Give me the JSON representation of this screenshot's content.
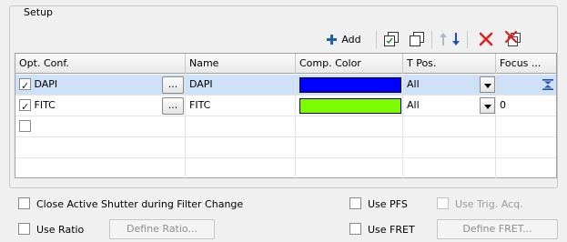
{
  "group": {
    "title": "Setup"
  },
  "toolbar": {
    "add_label": "Add",
    "add_icon": "plus-icon",
    "colors": {
      "plus": "#2060b0",
      "delete": "#e02020",
      "arrow_up": "#b0b8c8",
      "arrow_down": "#2050b0"
    }
  },
  "table": {
    "columns": [
      "Opt. Conf.",
      "Name",
      "Comp. Color",
      "T Pos.",
      "Focus ..."
    ],
    "rows": [
      {
        "checked": true,
        "opt_conf": "DAPI",
        "name": "DAPI",
        "color": "#0000ff",
        "t_pos": "All",
        "focus": "",
        "selected": true
      },
      {
        "checked": true,
        "opt_conf": "FITC",
        "name": "FITC",
        "color": "#7cfc00",
        "t_pos": "All",
        "focus": "0",
        "selected": false
      },
      {
        "checked": false,
        "opt_conf": "",
        "name": "",
        "color": "",
        "t_pos": "",
        "focus": "",
        "selected": false
      }
    ],
    "ellipsis": "..."
  },
  "options": {
    "close_shutter": "Close Active Shutter during Filter Change",
    "use_pfs": "Use PFS",
    "use_trig_acq": "Use Trig. Acq.",
    "use_ratio": "Use Ratio",
    "define_ratio": "Define Ratio...",
    "use_fret": "Use FRET",
    "define_fret": "Define FRET..."
  }
}
